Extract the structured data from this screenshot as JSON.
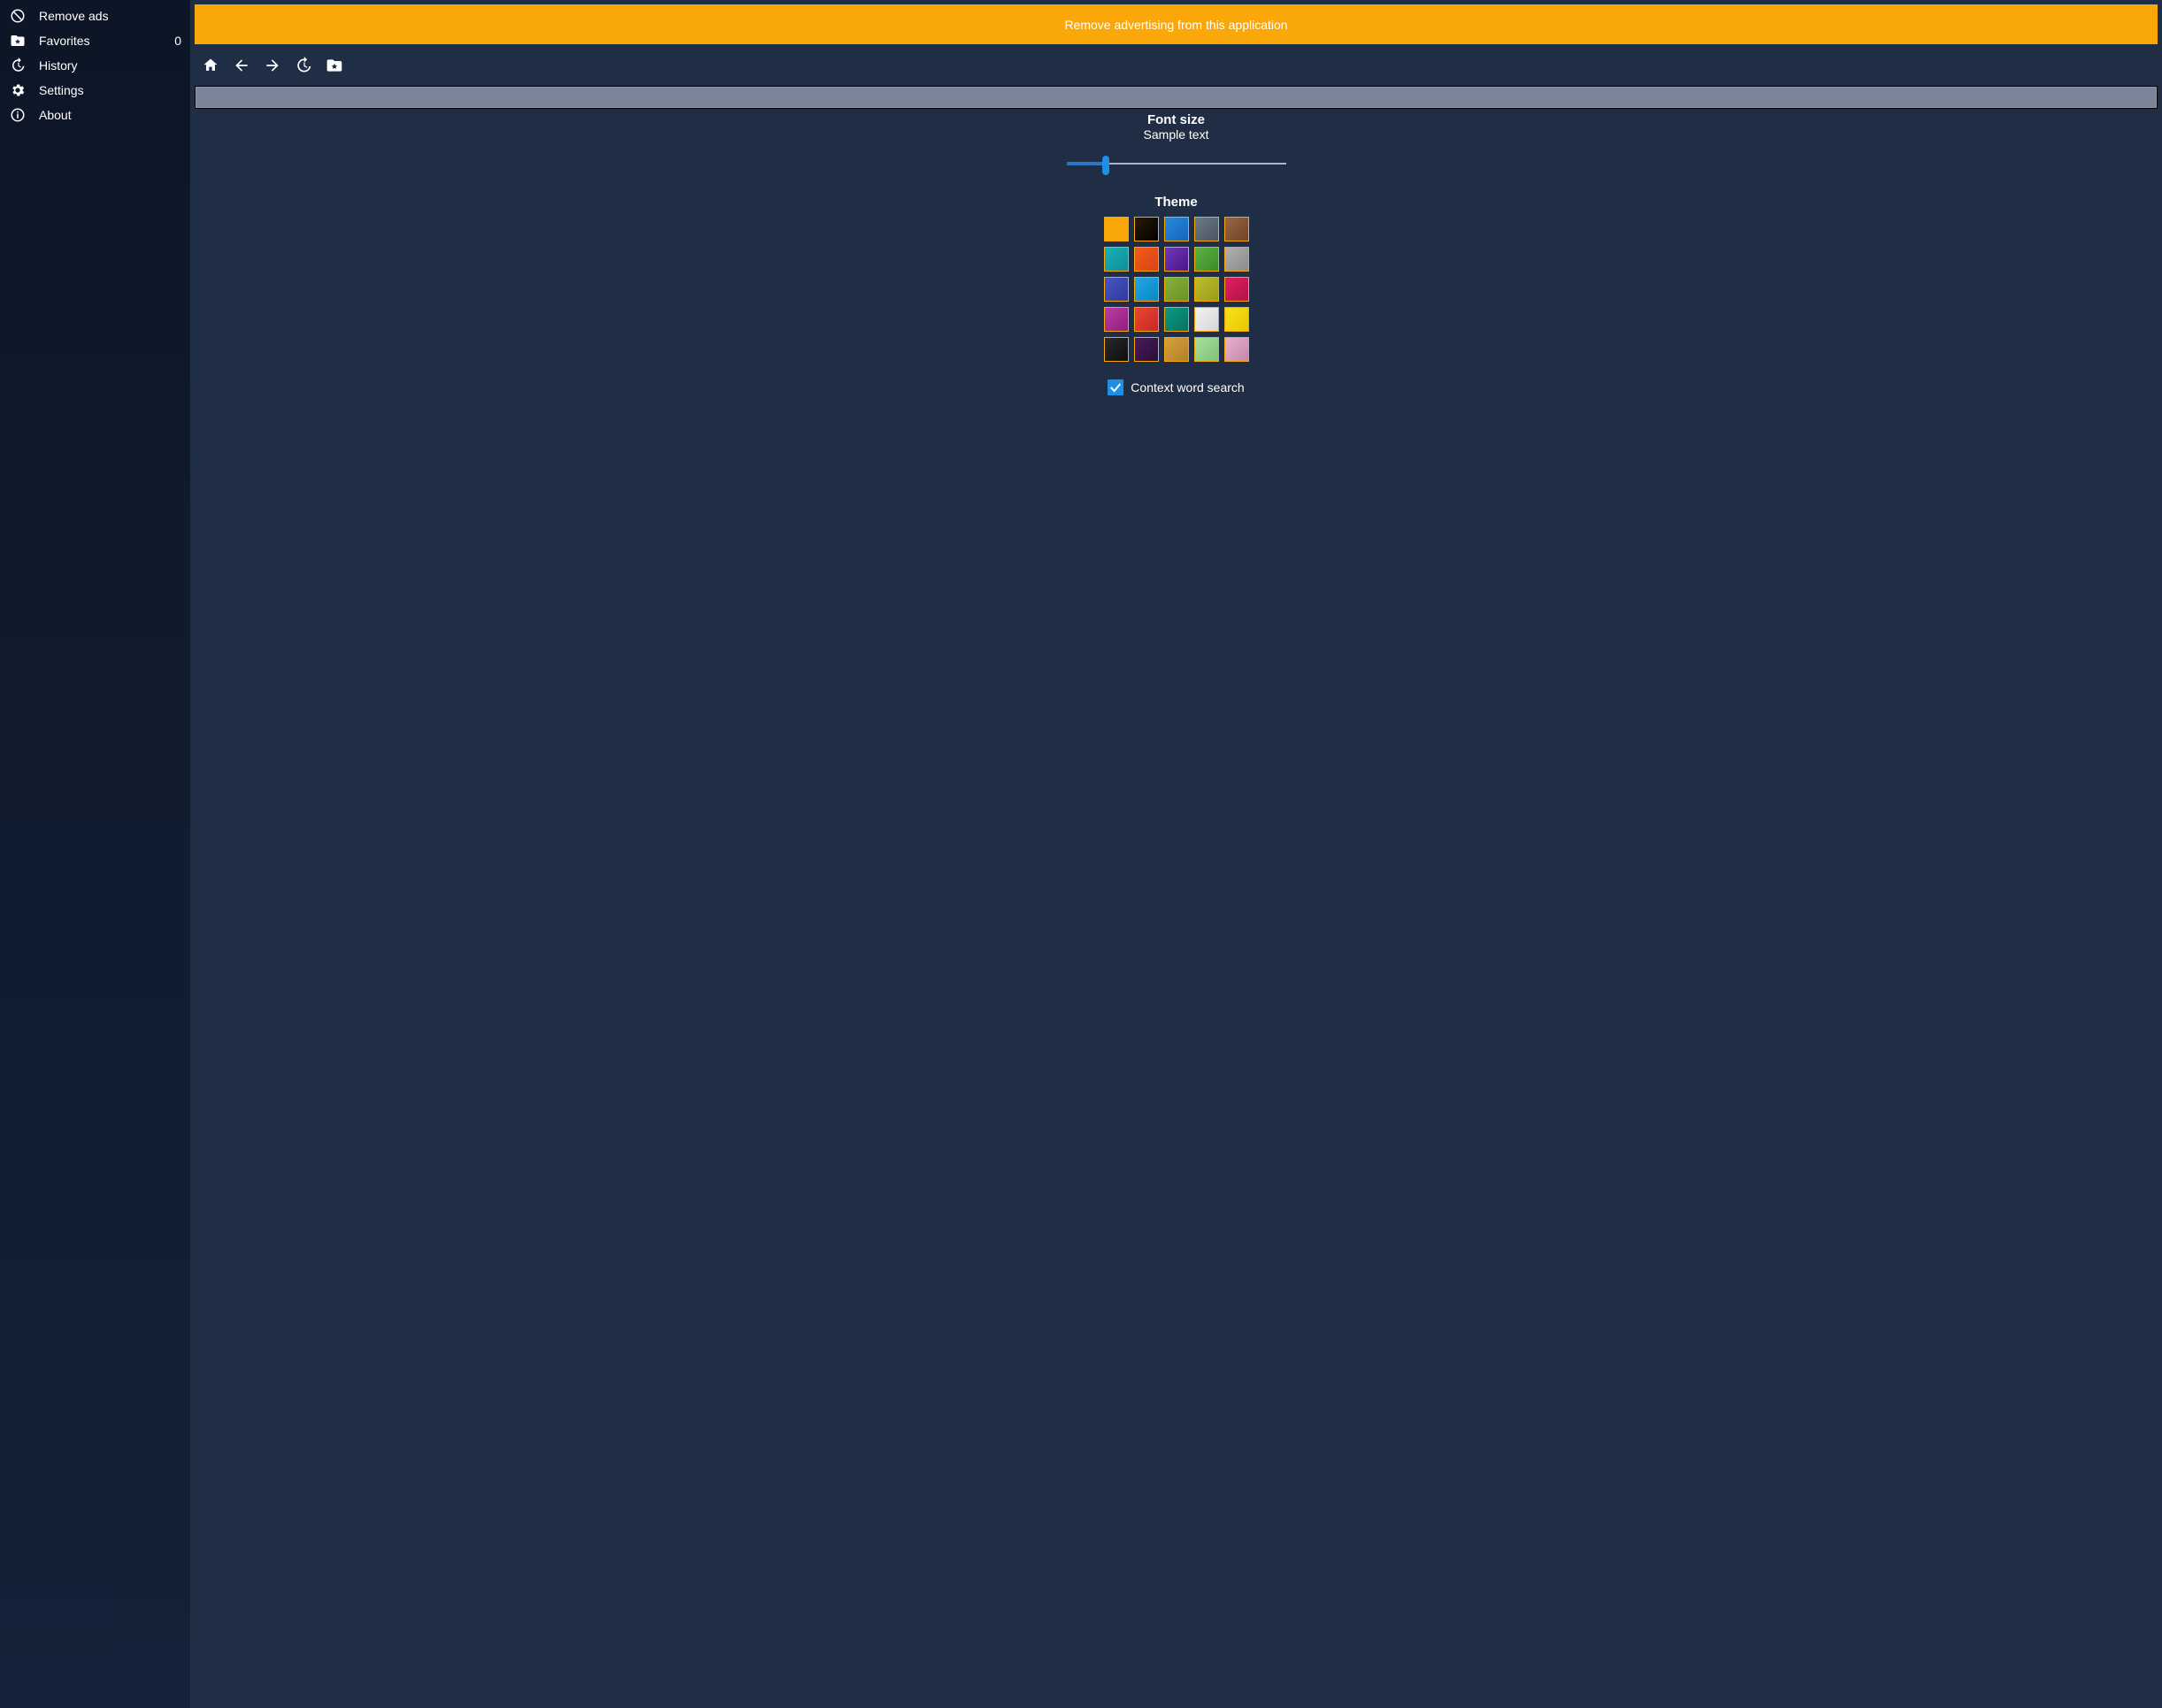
{
  "sidebar": {
    "items": [
      {
        "icon": "block",
        "label": "Remove ads",
        "badge": null
      },
      {
        "icon": "folder-star",
        "label": "Favorites",
        "badge": "0"
      },
      {
        "icon": "history",
        "label": "History",
        "badge": null
      },
      {
        "icon": "gear",
        "label": "Settings",
        "badge": null
      },
      {
        "icon": "info",
        "label": "About",
        "badge": null
      }
    ]
  },
  "banner": {
    "text": "Remove advertising from this application"
  },
  "toolbar": {
    "buttons": [
      {
        "name": "home",
        "icon": "home",
        "disabled": false
      },
      {
        "name": "back",
        "icon": "arrow-left",
        "disabled": false
      },
      {
        "name": "forward",
        "icon": "arrow-right",
        "disabled": true
      },
      {
        "name": "history",
        "icon": "history",
        "disabled": false
      },
      {
        "name": "favorites",
        "icon": "folder-star",
        "disabled": false
      }
    ]
  },
  "search": {
    "value": ""
  },
  "settings": {
    "fontsize_title": "Font size",
    "sample_text": "Sample text",
    "slider_percent": 18,
    "theme_title": "Theme",
    "theme_colors": [
      [
        {
          "name": "orange",
          "c1": "#f9a709",
          "c2": "#f9a709"
        },
        {
          "name": "black",
          "c1": "#2a1a05",
          "c2": "#000000"
        },
        {
          "name": "blue",
          "c1": "#2a89d9",
          "c2": "#1565c0"
        },
        {
          "name": "slate",
          "c1": "#6b7a87",
          "c2": "#4a5560"
        },
        {
          "name": "brown",
          "c1": "#9a6640",
          "c2": "#6d4528"
        }
      ],
      [
        {
          "name": "teal",
          "c1": "#17b2b8",
          "c2": "#0d8e94"
        },
        {
          "name": "deep-orange",
          "c1": "#f25c19",
          "c2": "#d84315"
        },
        {
          "name": "violet",
          "c1": "#7239b8",
          "c2": "#4a148c"
        },
        {
          "name": "green",
          "c1": "#5fb341",
          "c2": "#3b8a26"
        },
        {
          "name": "gray",
          "c1": "#b0b0b0",
          "c2": "#8a8a8a"
        }
      ],
      [
        {
          "name": "indigo",
          "c1": "#4a55c4",
          "c2": "#2e3a9c"
        },
        {
          "name": "sky",
          "c1": "#21a7e6",
          "c2": "#0d86c4"
        },
        {
          "name": "olive",
          "c1": "#87b335",
          "c2": "#6a8f28"
        },
        {
          "name": "yellow-olive",
          "c1": "#bfbf2a",
          "c2": "#9a9a1a"
        },
        {
          "name": "pink-red",
          "c1": "#e01f5f",
          "c2": "#b0134a"
        }
      ],
      [
        {
          "name": "magenta",
          "c1": "#bf3aa8",
          "c2": "#8e1f7d"
        },
        {
          "name": "red",
          "c1": "#e8482e",
          "c2": "#c62828"
        },
        {
          "name": "dark-teal",
          "c1": "#0d9b85",
          "c2": "#06705f"
        },
        {
          "name": "white",
          "c1": "#f2f2f2",
          "c2": "#d6d6d6"
        },
        {
          "name": "yellow",
          "c1": "#f9e21a",
          "c2": "#e6c800"
        }
      ],
      [
        {
          "name": "near-black",
          "c1": "#2a2a2a",
          "c2": "#0d0d0d"
        },
        {
          "name": "dark-purple",
          "c1": "#4a1a5c",
          "c2": "#2a0d3a"
        },
        {
          "name": "gold",
          "c1": "#d9a23e",
          "c2": "#b07f28"
        },
        {
          "name": "mint",
          "c1": "#a8e0a0",
          "c2": "#7fc276"
        },
        {
          "name": "rose",
          "c1": "#e8b3ce",
          "c2": "#c787aa"
        }
      ]
    ],
    "checkbox_label": "Context word search",
    "checkbox_checked": true
  }
}
